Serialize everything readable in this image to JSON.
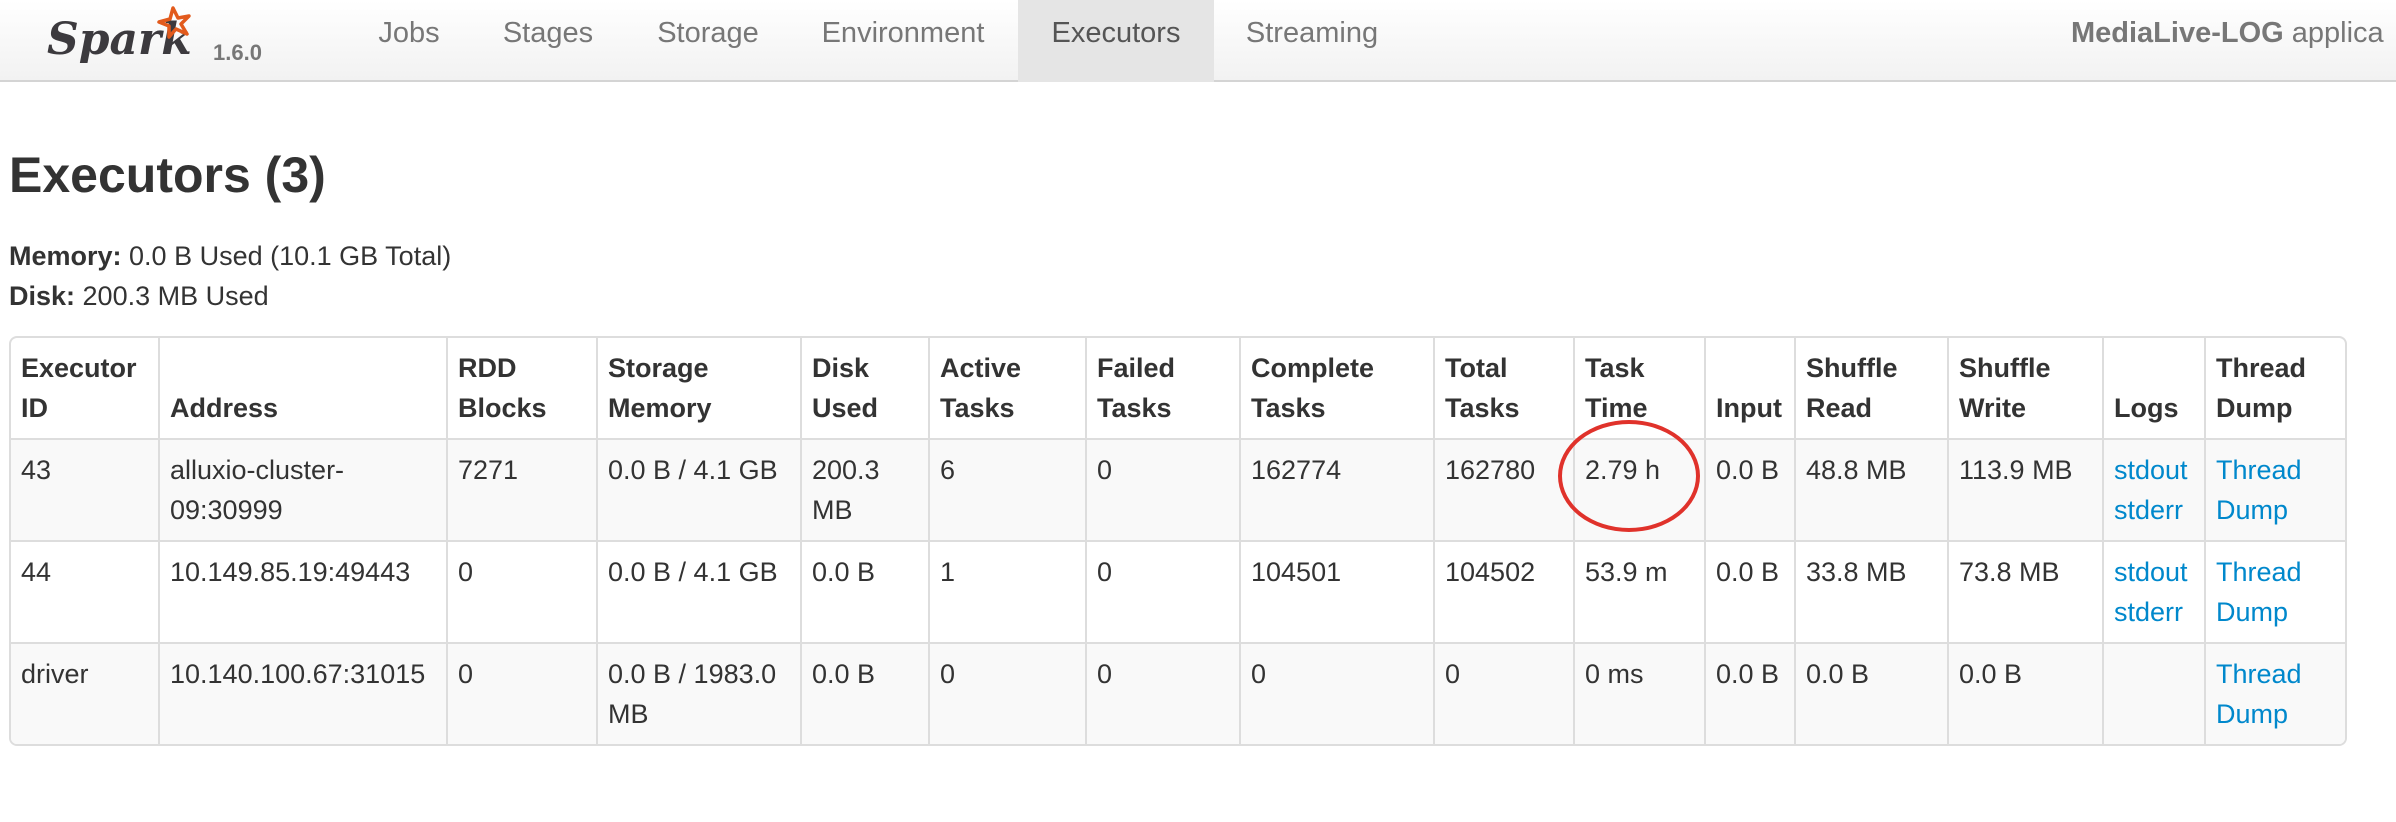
{
  "brand": {
    "name": "Spark",
    "version": "1.6.0"
  },
  "nav": {
    "items": [
      {
        "label": "Jobs"
      },
      {
        "label": "Stages"
      },
      {
        "label": "Storage"
      },
      {
        "label": "Environment"
      },
      {
        "label": "Executors"
      },
      {
        "label": "Streaming"
      }
    ],
    "active": "Executors",
    "app_name_bold": "MediaLive-LOG",
    "app_name_rest": " applica"
  },
  "page": {
    "title": "Executors (3)",
    "memory_label": "Memory:",
    "memory_value": " 0.0 B Used (10.1 GB Total)",
    "disk_label": "Disk:",
    "disk_value": " 200.3 MB Used"
  },
  "table": {
    "headers": [
      "Executor ID",
      "Address",
      "RDD Blocks",
      "Storage Memory",
      "Disk Used",
      "Active Tasks",
      "Failed Tasks",
      "Complete Tasks",
      "Total Tasks",
      "Task Time",
      "Input",
      "Shuffle Read",
      "Shuffle Write",
      "Logs",
      "Thread Dump"
    ],
    "rows": [
      {
        "id": "43",
        "address": "alluxio-cluster-09:30999",
        "rdd_blocks": "7271",
        "storage_memory": "0.0 B / 4.1 GB",
        "disk_used": "200.3 MB",
        "active_tasks": "6",
        "failed_tasks": "0",
        "complete_tasks": "162774",
        "total_tasks": "162780",
        "task_time": "2.79 h",
        "input": "0.0 B",
        "shuffle_read": "48.8 MB",
        "shuffle_write": "113.9 MB",
        "stdout": "stdout",
        "stderr": "stderr",
        "thread_dump": "Thread Dump"
      },
      {
        "id": "44",
        "address": "10.149.85.19:49443",
        "rdd_blocks": "0",
        "storage_memory": "0.0 B / 4.1 GB",
        "disk_used": "0.0 B",
        "active_tasks": "1",
        "failed_tasks": "0",
        "complete_tasks": "104501",
        "total_tasks": "104502",
        "task_time": "53.9 m",
        "input": "0.0 B",
        "shuffle_read": "33.8 MB",
        "shuffle_write": "73.8 MB",
        "stdout": "stdout",
        "stderr": "stderr",
        "thread_dump": "Thread Dump"
      },
      {
        "id": "driver",
        "address": "10.140.100.67:31015",
        "rdd_blocks": "0",
        "storage_memory": "0.0 B / 1983.0 MB",
        "disk_used": "0.0 B",
        "active_tasks": "0",
        "failed_tasks": "0",
        "complete_tasks": "0",
        "total_tasks": "0",
        "task_time": "0 ms",
        "input": "0.0 B",
        "shuffle_read": "0.0 B",
        "shuffle_write": "0.0 B",
        "stdout": "",
        "stderr": "",
        "thread_dump": "Thread Dump"
      }
    ]
  },
  "colors": {
    "link": "#0088cc",
    "highlight_circle": "#e0322b",
    "logo_orange": "#e25a1c"
  },
  "icons": {
    "logo": "spark-logo-icon"
  }
}
